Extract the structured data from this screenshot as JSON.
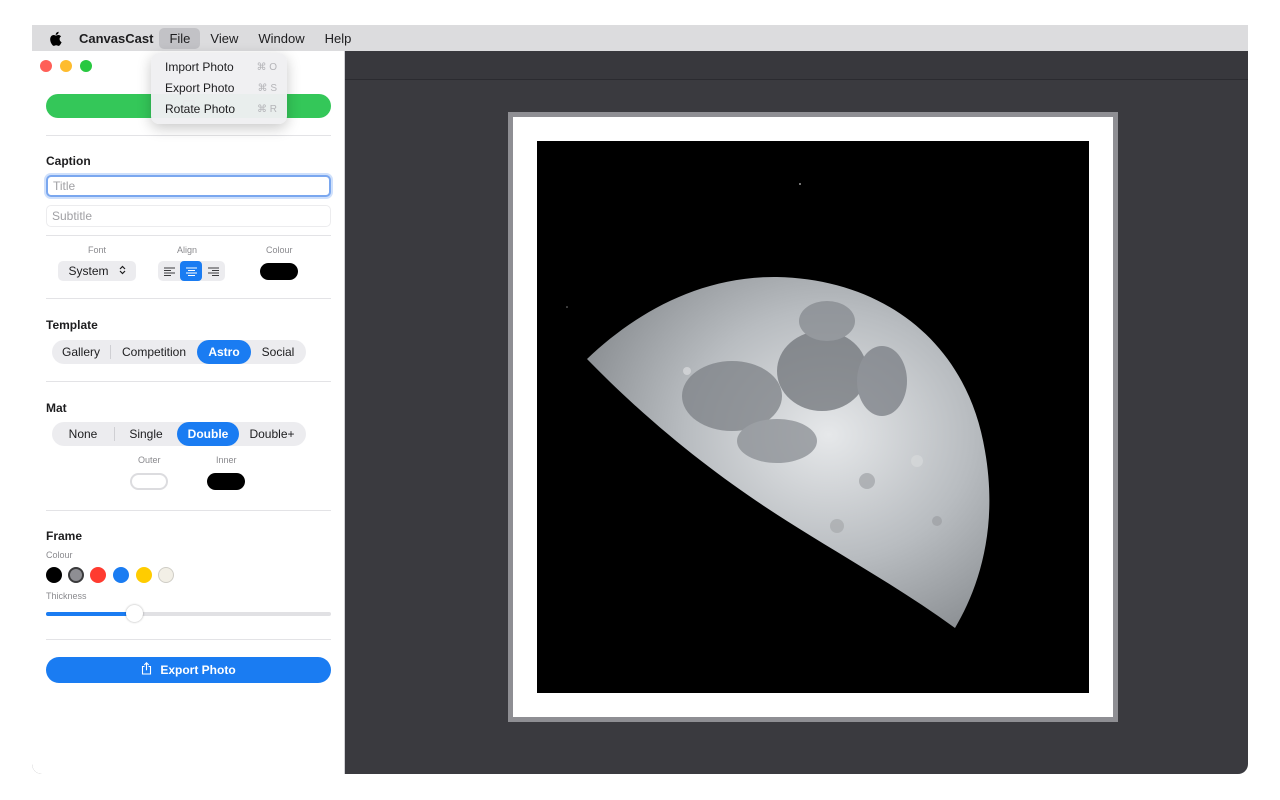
{
  "menubar": {
    "apple_icon": "apple-icon",
    "app_name": "CanvasCast",
    "menus": [
      "File",
      "View",
      "Window",
      "Help"
    ],
    "active_menu": "File"
  },
  "file_menu": {
    "items": [
      {
        "label": "Import Photo",
        "shortcut": "⌘ O"
      },
      {
        "label": "Export Photo",
        "shortcut": "⌘ S"
      },
      {
        "label": "Rotate Photo",
        "shortcut": "⌘ R"
      }
    ]
  },
  "sidebar": {
    "caption": {
      "title": "Caption",
      "title_placeholder": "Title",
      "subtitle_placeholder": "Subtitle",
      "font_label": "Font",
      "font_value": "System",
      "align_label": "Align",
      "align_selected": "center",
      "colour_label": "Colour",
      "colour_value": "#000000"
    },
    "template": {
      "title": "Template",
      "options": [
        "Gallery",
        "Competition",
        "Astro",
        "Social"
      ],
      "selected": "Astro"
    },
    "mat": {
      "title": "Mat",
      "options": [
        "None",
        "Single",
        "Double",
        "Double+"
      ],
      "selected": "Double",
      "outer_label": "Outer",
      "outer_colour": "#ffffff",
      "inner_label": "Inner",
      "inner_colour": "#000000"
    },
    "frame": {
      "title": "Frame",
      "colour_label": "Colour",
      "swatches": [
        "#000000",
        "#8e8e93",
        "#ff3b30",
        "#1a7cf2",
        "#ffcc00",
        "#f2efe6"
      ],
      "selected_swatch": "#8e8e93",
      "thickness_label": "Thickness",
      "thickness_value": 0.31
    },
    "export_button": "Export Photo"
  },
  "colors": {
    "accent": "#1a7cf2",
    "import_green": "#34c759",
    "canvas_bg": "#3a3a3f"
  }
}
